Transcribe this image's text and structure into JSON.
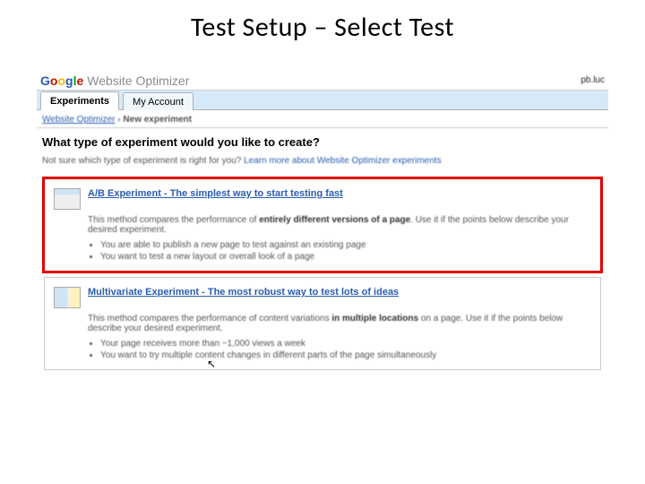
{
  "slide_title": "Test Setup – Select Test",
  "logo_greytext": "Website Optimizer",
  "user_label": "pb.luc",
  "tabs": {
    "experiments": "Experiments",
    "account": "My Account"
  },
  "breadcrumb": {
    "root": "Website Optimizer",
    "sep": " › ",
    "current": "New experiment"
  },
  "question": "What type of experiment would you like to create?",
  "subnote_prefix": "Not sure which type of experiment is right for you? ",
  "subnote_link": "Learn more about Website Optimizer experiments",
  "ab": {
    "title": "A/B Experiment - The simplest way to start testing fast",
    "desc_a": "This method compares the performance of ",
    "desc_bold": "entirely different versions of a page",
    "desc_b": ". Use it if the points below describe your desired experiment.",
    "bullet1": "You are able to publish a new page to test against an existing page",
    "bullet2": "You want to test a new layout or overall look of a page"
  },
  "mvt": {
    "title": "Multivariate Experiment - The most robust way to test lots of ideas",
    "desc_a": "This method compares the performance of content variations ",
    "desc_bold": "in multiple locations",
    "desc_b": " on a page. Use it if the points below describe your desired experiment.",
    "bullet1": "Your page receives more than ~1,000 views a week",
    "bullet2": "You want to try multiple content changes in different parts of the page simultaneously"
  }
}
